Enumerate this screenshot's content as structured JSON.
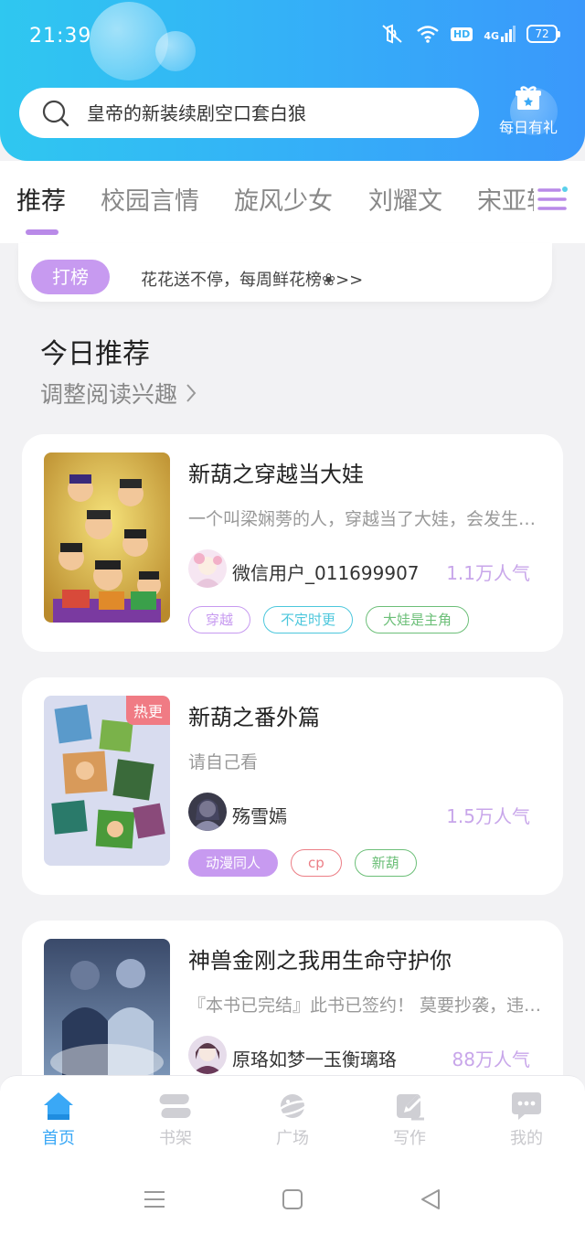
{
  "status_bar": {
    "time": "21:39",
    "hd": "HD",
    "network": "4G",
    "battery": "72"
  },
  "search": {
    "placeholder": "皇帝的新装续剧空口套白狼"
  },
  "daily_gift": {
    "label": "每日有礼"
  },
  "tabs": [
    "推荐",
    "校园言情",
    "旋风少女",
    "刘耀文",
    "宋亚轩"
  ],
  "ranking": {
    "badge": "打榜",
    "text": "花花送不停，每周鲜花榜❀>>"
  },
  "section": {
    "title": "今日推荐",
    "subtitle": "调整阅读兴趣"
  },
  "books": [
    {
      "title": "新葫之穿越当大娃",
      "description": "一个叫梁娴蒡的人，穿越当了大娃，会发生什么事呢？",
      "author": "微信用户_011699907",
      "popularity": "1.1万人气",
      "hot_badge": "",
      "tags": [
        {
          "label": "穿越",
          "color": "#c79af0"
        },
        {
          "label": "不定时更",
          "color": "#4cc7dc"
        },
        {
          "label": "大娃是主角",
          "color": "#6cbf78"
        }
      ]
    },
    {
      "title": "新葫之番外篇",
      "description": "请自己看",
      "author": "殇雪嫣",
      "popularity": "1.5万人气",
      "hot_badge": "热更",
      "tags": [
        {
          "label": "动漫同人",
          "color": "#c79af0"
        },
        {
          "label": "cp",
          "color": "#ec7e86"
        },
        {
          "label": "新葫",
          "color": "#6cbf78"
        }
      ]
    },
    {
      "title": "神兽金刚之我用生命守护你",
      "description": "『本书已完结』此书已签约！ 莫要抄袭，违者必究",
      "author": "原珞如梦一玉衡璃珞",
      "popularity": "88万人气",
      "hot_badge": "",
      "tags": []
    }
  ],
  "bottom_nav": [
    {
      "label": "首页",
      "icon": "home-icon",
      "active": true
    },
    {
      "label": "书架",
      "icon": "bookshelf-icon",
      "active": false
    },
    {
      "label": "广场",
      "icon": "planet-icon",
      "active": false
    },
    {
      "label": "写作",
      "icon": "pen-icon",
      "active": false
    },
    {
      "label": "我的",
      "icon": "chat-bubble-icon",
      "active": false
    }
  ],
  "colors": {
    "header_start": "#2fc7f0",
    "header_end": "#3a98fb",
    "accent_purple": "#c79af0",
    "nav_active": "#3aa8f6"
  }
}
